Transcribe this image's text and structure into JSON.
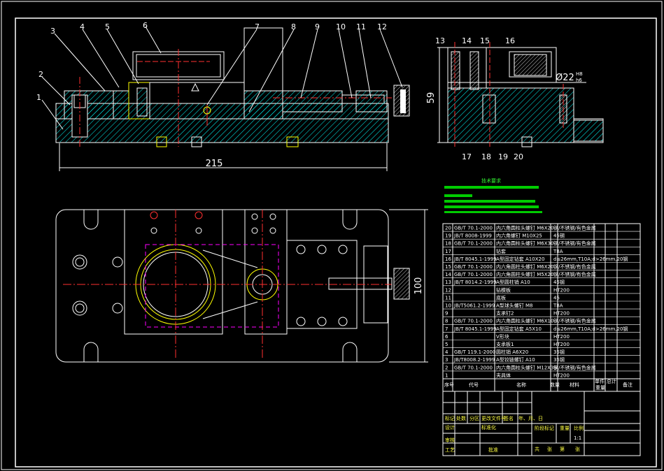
{
  "colors": {
    "background": "#000000",
    "frame": "#ffffff",
    "hatch": "#00ffff",
    "centerline": "#ff3030",
    "part_yellow": "#ffff00",
    "annotation_green": "#00ff00",
    "magenta": "#ff00ff"
  },
  "part_numbers_front": [
    "1",
    "2",
    "3",
    "4",
    "5",
    "6",
    "7",
    "8",
    "9",
    "10",
    "11",
    "12"
  ],
  "part_numbers_side": [
    "13",
    "14",
    "15",
    "16",
    "17",
    "18",
    "19",
    "20"
  ],
  "dimensions": {
    "overall_length": "215",
    "side_height": "59",
    "plan_width": "100",
    "bore_diameter": "Ø22",
    "bore_tol_upper": "H8",
    "bore_tol_lower": "h6"
  },
  "notes": {
    "title": "技术要求"
  },
  "bom_header": {
    "seq": "序号",
    "code": "代号",
    "name": "名称",
    "qty": "数量",
    "material": "材料",
    "unit_weight": "单件",
    "total_weight": "总计",
    "weight": "重量",
    "remark": "备注"
  },
  "bom_rows": [
    {
      "seq": "20",
      "code": "GB/T 70.1-2000",
      "name": "内六角圆柱头螺钉 M6X20",
      "material": "钢/不锈钢/有色金属"
    },
    {
      "seq": "19",
      "code": "JB/T 8008-1999",
      "name": "内六角螺钉 M10X25",
      "material": "45钢"
    },
    {
      "seq": "18",
      "code": "GB/T 70.1-2000",
      "name": "内六角圆柱头螺钉 M6X30",
      "material": "钢/不锈钢/有色金属"
    },
    {
      "seq": "17",
      "code": "",
      "name": "钻套",
      "material": "T8A"
    },
    {
      "seq": "16",
      "code": "JB/T 8045.1-1999",
      "name": "A型固定钻套 A10X20",
      "material": "d≤26mm,T10A;d>26mm,20钢"
    },
    {
      "seq": "15",
      "code": "GB/T 70.1-2000",
      "name": "内六角圆柱头螺钉 M6X20",
      "material": "钢/不锈钢/有色金属"
    },
    {
      "seq": "14",
      "code": "GB/T 70.1-2000",
      "name": "内六角圆柱头螺钉 M5X20",
      "material": "钢/不锈钢/有色金属"
    },
    {
      "seq": "13",
      "code": "JB/T 8014.2-1999",
      "name": "A型圆柱销 A10",
      "material": "45钢"
    },
    {
      "seq": "12",
      "code": "",
      "name": "钻模板",
      "material": "HT200"
    },
    {
      "seq": "11",
      "code": "",
      "name": "底板",
      "material": "45"
    },
    {
      "seq": "10",
      "code": "JB/T5061.2-1999",
      "name": "A型球头螺钉 M8",
      "material": "T8A"
    },
    {
      "seq": "9",
      "code": "",
      "name": "支承钉2",
      "material": "HT200"
    },
    {
      "seq": "8",
      "code": "GB/T 70.1-2000",
      "name": "内六角圆柱头螺钉 M6X10",
      "material": "钢/不锈钢/有色金属"
    },
    {
      "seq": "7",
      "code": "JB/T 8045.1-1999",
      "name": "A型固定钻套 A5X10",
      "material": "d≤26mm,T10A;d>26mm,20钢"
    },
    {
      "seq": "6",
      "code": "",
      "name": "V形块",
      "material": "HT200"
    },
    {
      "seq": "5",
      "code": "",
      "name": "支承板1",
      "material": "HT200"
    },
    {
      "seq": "4",
      "code": "GB/T 119.1-2000",
      "name": "圆柱销 A6X20",
      "material": "35钢"
    },
    {
      "seq": "3",
      "code": "JB/T8008.2-1999",
      "name": "A型铰链螺钉 A10",
      "material": "35钢"
    },
    {
      "seq": "2",
      "code": "GB/T 70.1-2000",
      "name": "内六角圆柱头螺钉 M12X35",
      "material": "钢/不锈钢/有色金属"
    },
    {
      "seq": "1",
      "code": "",
      "name": "夹具体",
      "material": "HT200"
    }
  ],
  "title_block": {
    "mark": "标记",
    "count": "处数",
    "zone": "分区",
    "change_doc": "更改文件号",
    "sign": "签名",
    "date": "年、月、日",
    "design": "设计",
    "standard": "标准化",
    "review": "审核",
    "process": "工艺",
    "approve": "批准",
    "stage_mark": "阶段标记",
    "weight": "重量",
    "scale": "比例",
    "scale_val": "1:1",
    "sheets_total": "共",
    "sheet_unit": "张",
    "sheet_no": "第"
  }
}
